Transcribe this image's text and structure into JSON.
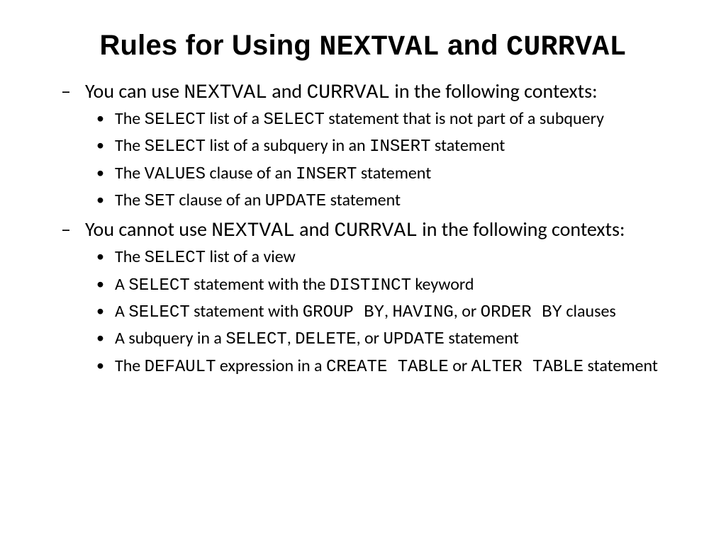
{
  "title": {
    "t1": "Rules for Using ",
    "c1": "NEXTVAL",
    "t2": " and ",
    "c2": "CURRVAL"
  },
  "section1": {
    "lead": {
      "t1": "You can use ",
      "c1": "NEXTVAL",
      "t2": " and ",
      "c2": "CURRVAL",
      "t3": " in the following contexts:"
    },
    "item1": {
      "t1": "The ",
      "c1": "SELECT",
      "t2": " list of a ",
      "c2": "SELECT",
      "t3": " statement that is not part of a subquery"
    },
    "item2": {
      "t1": "The ",
      "c1": "SELECT",
      "t2": " list of a subquery in an ",
      "c2": "INSERT",
      "t3": " statement"
    },
    "item3": {
      "t1": "The ",
      "c1": "VALUES",
      "t2": " clause of an ",
      "c2": "INSERT",
      "t3": " statement"
    },
    "item4": {
      "t1": "The ",
      "c1": "SET",
      "t2": " clause of an ",
      "c2": "UPDATE",
      "t3": " statement"
    }
  },
  "section2": {
    "lead": {
      "t1": "You cannot use ",
      "c1": "NEXTVAL",
      "t2": " and ",
      "c2": "CURRVAL",
      "t3": " in the following contexts:"
    },
    "item1": {
      "t1": "The ",
      "c1": "SELECT",
      "t2": " list of a view"
    },
    "item2": {
      "t1": "A ",
      "c1": "SELECT",
      "t2": " statement with the ",
      "c2": "DISTINCT",
      "t3": " keyword"
    },
    "item3": {
      "t1": "A ",
      "c1": "SELECT",
      "t2": " statement with ",
      "c2": "GROUP BY",
      "t3": ", ",
      "c3": "HAVING",
      "t4": ", or ",
      "c4": "ORDER BY",
      "t5": " clauses"
    },
    "item4": {
      "t1": "A subquery in a ",
      "c1": "SELECT",
      "t2": ", ",
      "c2": "DELETE",
      "t3": ", or ",
      "c3": "UPDATE",
      "t4": " statement"
    },
    "item5": {
      "t1": "The ",
      "c1": "DEFAULT",
      "t2": " expression in a ",
      "c2": "CREATE TABLE",
      "t3": " or ",
      "c3": "ALTER TABLE",
      "t4": " statement"
    }
  }
}
